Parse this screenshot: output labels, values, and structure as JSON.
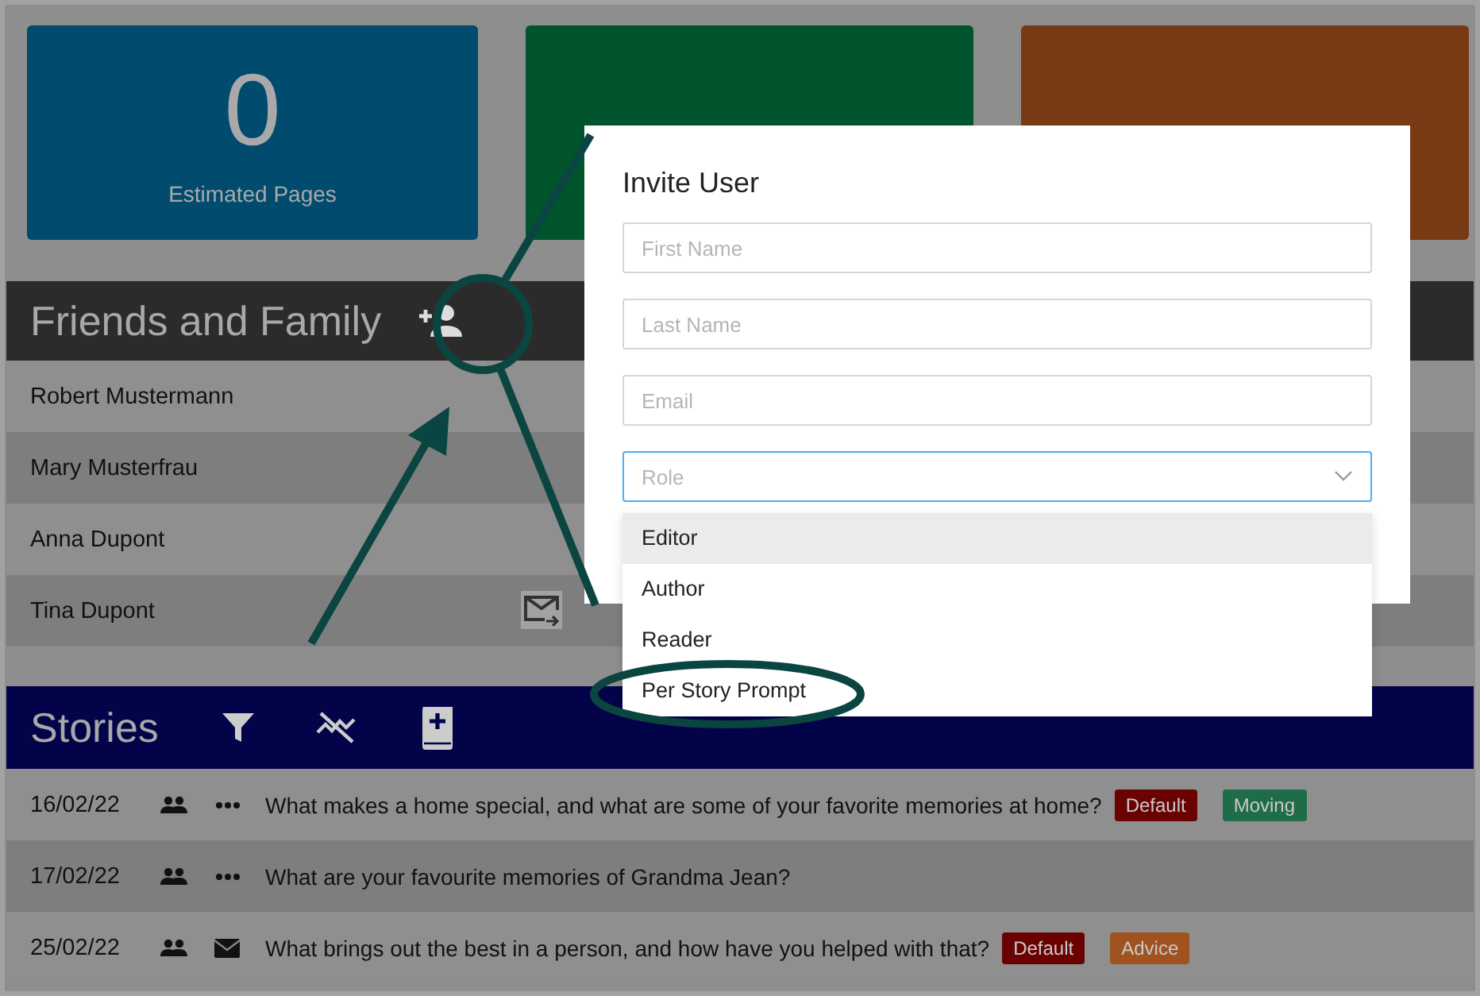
{
  "stats": [
    {
      "value": "0",
      "label": "Estimated Pages",
      "color": "#004b6e"
    },
    {
      "color": "#00552d"
    },
    {
      "color": "#773a14"
    }
  ],
  "friends": {
    "title": "Friends and Family",
    "members": [
      {
        "name": "Robert Mustermann",
        "invite_pending": false
      },
      {
        "name": "Mary Musterfrau",
        "invite_pending": false
      },
      {
        "name": "Anna Dupont",
        "invite_pending": false
      },
      {
        "name": "Tina Dupont",
        "invite_pending": true
      }
    ]
  },
  "stories": {
    "title": "Stories",
    "rows": [
      {
        "date": "16/02/22",
        "emailed": false,
        "question": "What makes a home special, and what are some of your favorite memories at home?",
        "tags": [
          {
            "label": "Default",
            "color": "#6b0202"
          },
          {
            "label": "Moving",
            "color": "#1e6d48"
          }
        ]
      },
      {
        "date": "17/02/22",
        "emailed": false,
        "question": "What are your favourite memories of Grandma Jean?",
        "tags": []
      },
      {
        "date": "25/02/22",
        "emailed": true,
        "question": "What brings out the best in a person, and how have you helped with that?",
        "tags": [
          {
            "label": "Default",
            "color": "#6b0202"
          },
          {
            "label": "Advice",
            "color": "#a0521f"
          }
        ]
      }
    ]
  },
  "dialog": {
    "title": "Invite User",
    "fields": [
      {
        "placeholder": "First Name"
      },
      {
        "placeholder": "Last Name"
      },
      {
        "placeholder": "Email"
      }
    ],
    "role": {
      "placeholder": "Role",
      "focused": true,
      "options": [
        {
          "label": "Editor",
          "highlighted": true
        },
        {
          "label": "Author",
          "highlighted": false
        },
        {
          "label": "Reader",
          "highlighted": false
        },
        {
          "label": "Per Story Prompt",
          "highlighted": false
        }
      ]
    }
  }
}
